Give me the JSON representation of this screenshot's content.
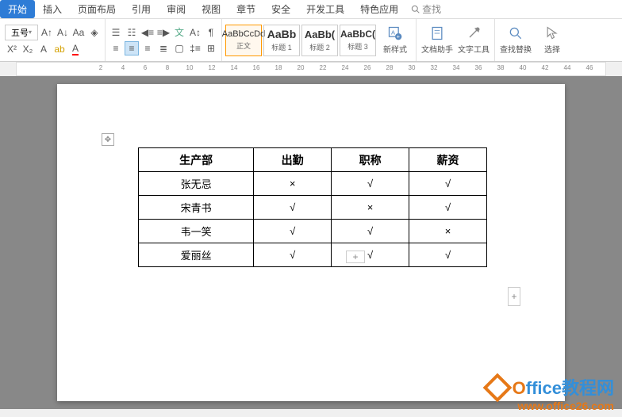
{
  "tabs": {
    "items": [
      "开始",
      "插入",
      "页面布局",
      "引用",
      "审阅",
      "视图",
      "章节",
      "安全",
      "开发工具",
      "特色应用"
    ],
    "activeIndex": 0,
    "search": "查找"
  },
  "ribbon": {
    "fontSize": "五号",
    "styles": [
      {
        "preview": "AaBbCcDd",
        "label": "正文"
      },
      {
        "preview": "AaBb",
        "label": "标题 1"
      },
      {
        "preview": "AaBb(",
        "label": "标题 2"
      },
      {
        "preview": "AaBbC(",
        "label": "标题 3"
      }
    ],
    "newStyle": "新样式",
    "docHelper": "文档助手",
    "textTool": "文字工具",
    "findReplace": "查找替换",
    "select": "选择"
  },
  "ruler": [
    "2",
    "4",
    "6",
    "8",
    "10",
    "12",
    "14",
    "16",
    "18",
    "20",
    "22",
    "24",
    "26",
    "28",
    "30",
    "32",
    "34",
    "36",
    "38",
    "40",
    "42",
    "44",
    "46"
  ],
  "table": {
    "headers": [
      "生产部",
      "出勤",
      "职称",
      "薪资"
    ],
    "rows": [
      [
        "张无忌",
        "×",
        "√",
        "√"
      ],
      [
        "宋青书",
        "√",
        "×",
        "√"
      ],
      [
        "韦一笑",
        "√",
        "√",
        "×"
      ],
      [
        "爱丽丝",
        "√",
        "√",
        "√"
      ]
    ]
  },
  "watermark": {
    "line1a": "O",
    "line1b": "ffice教程网",
    "line2": "www.office26.com"
  }
}
